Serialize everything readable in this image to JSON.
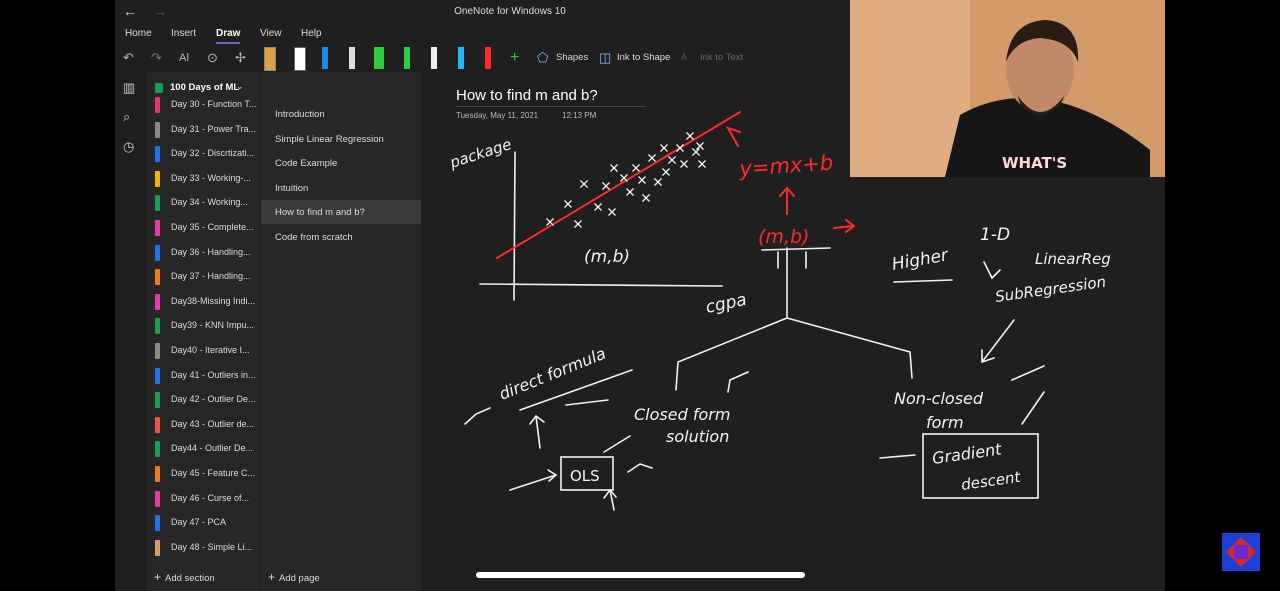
{
  "window": {
    "title": "OneNote for Windows 10",
    "back": "←",
    "forward": "→"
  },
  "menu": {
    "home": "Home",
    "insert": "Insert",
    "draw": "Draw",
    "view": "View",
    "help": "Help"
  },
  "toolbar": {
    "shapes": "Shapes",
    "ink_to_shape": "Ink to Shape",
    "ink_to_text": "Ink to Text"
  },
  "notebook": {
    "name": "100 Days of ML"
  },
  "sections": [
    {
      "label": "Day 30 - Function T...",
      "color": "#e8336c"
    },
    {
      "label": "Day 31 - Power Tra...",
      "color": "#8a8a8a"
    },
    {
      "label": "Day 32 - Discrtizati...",
      "color": "#1e73e8"
    },
    {
      "label": "Day 33 - Working-...",
      "color": "#f2b400"
    },
    {
      "label": "Day 34 - Working...",
      "color": "#1a9e55"
    },
    {
      "label": "Day 35 - Complete...",
      "color": "#e83aa9"
    },
    {
      "label": "Day 36 - Handling...",
      "color": "#1e73e8"
    },
    {
      "label": "Day 37 - Handling...",
      "color": "#f27a1a"
    },
    {
      "label": "Day38-Missing Indi...",
      "color": "#e83aa9"
    },
    {
      "label": "Day39 - KNN Impu...",
      "color": "#1a9e55"
    },
    {
      "label": "Day40 - Iterative I...",
      "color": "#8a8a8a"
    },
    {
      "label": "Day 41 - Outliers in...",
      "color": "#1e73e8"
    },
    {
      "label": "Day 42 - Outlier De...",
      "color": "#1a9e55"
    },
    {
      "label": "Day 43 - Outlier de...",
      "color": "#e8564a"
    },
    {
      "label": "Day44 - Outlier De...",
      "color": "#1a9e55"
    },
    {
      "label": "Day 45 - Feature C...",
      "color": "#f27a1a"
    },
    {
      "label": "Day 46 - Curse of...",
      "color": "#e83aa9"
    },
    {
      "label": "Day 47 - PCA",
      "color": "#1e73e8"
    },
    {
      "label": "Day 48 - Simple Li...",
      "color": "#d9a06b"
    }
  ],
  "pages": [
    {
      "label": "Introduction"
    },
    {
      "label": "Simple Linear Regression"
    },
    {
      "label": "Code Example"
    },
    {
      "label": "Intuition"
    },
    {
      "label": "How to find m and b?"
    },
    {
      "label": "Code from scratch"
    }
  ],
  "add_section": "Add section",
  "add_page": "Add page",
  "page": {
    "title": "How to find m and b?",
    "date": "Tuesday, May 11, 2021",
    "time": "12:13 PM"
  },
  "ink_notes": {
    "y_axis": "package",
    "x_axis": "cgpa",
    "equation": "y=mx+b",
    "params": "(m,b)",
    "params_red": "(m,b)",
    "higher": "Higher",
    "one_d": "1-D",
    "linear_reg": "LinearReg",
    "sub_regression": "SubRegression",
    "direct_formula": "direct formula",
    "closed_form": "Closed form",
    "solution": "solution",
    "ols": "OLS",
    "non_closed": "Non-closed",
    "form": "form",
    "gradient": "Gradient",
    "descent": "descent"
  },
  "webcam": {
    "shirt_text": "WHAT'S"
  },
  "colors": {
    "accent": "#7d5cc6",
    "ink_red": "#ff2b2b",
    "ink_white": "#f2f2f2",
    "bg": "#1f1f1f"
  }
}
